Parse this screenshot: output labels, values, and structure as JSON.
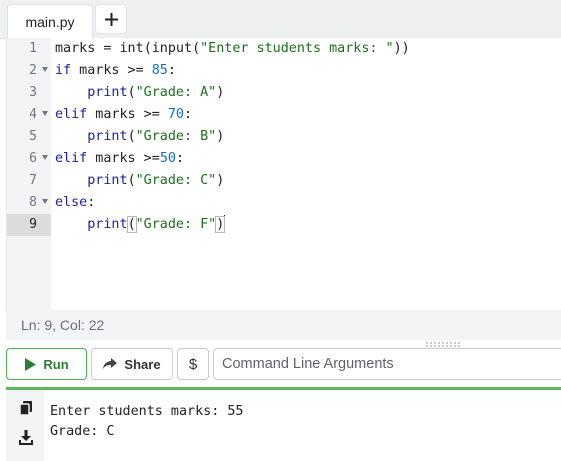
{
  "tabs": {
    "active_file": "main.py",
    "add_label": "+"
  },
  "editor": {
    "line_numbers": [
      "1",
      "2",
      "3",
      "4",
      "5",
      "6",
      "7",
      "8",
      "9"
    ]
  },
  "code": {
    "l1": {
      "a": "marks = ",
      "b": "int",
      "c": "(",
      "d": "input",
      "e": "(",
      "f": "\"Enter students marks: \"",
      "g": "))"
    },
    "l2": {
      "kw": "if",
      "mid": " marks >= ",
      "num": "85",
      "end": ":"
    },
    "l3": {
      "indent": "    ",
      "fn": "print",
      "open": "(",
      "str": "\"Grade: A\"",
      "close": ")"
    },
    "l4": {
      "kw": "elif",
      "mid": " marks >= ",
      "num": "70",
      "end": ":"
    },
    "l5": {
      "indent": "    ",
      "fn": "print",
      "open": "(",
      "str": "\"Grade: B\"",
      "close": ")"
    },
    "l6": {
      "kw": "elif",
      "mid": " marks >=",
      "num": "50",
      "end": ":"
    },
    "l7": {
      "indent": "    ",
      "fn": "print",
      "open": "(",
      "str": "\"Grade: C\"",
      "close": ")"
    },
    "l8": {
      "kw": "else",
      "end": ":"
    },
    "l9": {
      "indent": "    ",
      "fn": "print",
      "open": "(",
      "str": "\"Grade: F\"",
      "close": ")"
    }
  },
  "status": {
    "position": "Ln: 9,  Col: 22"
  },
  "toolbar": {
    "run_label": "Run",
    "share_label": "Share",
    "dollar_label": "$",
    "args_placeholder": "Command Line Arguments"
  },
  "output": {
    "line1": "Enter students marks: 55",
    "line2": "Grade: C"
  },
  "colors": {
    "keyword": "#1e1ea8",
    "string": "#1e6e1e",
    "number": "#0b6ed0",
    "run_accent": "#2e7d32",
    "output_border": "#5cb85c"
  },
  "icons": {
    "run": "play-icon",
    "share": "share-arrow-icon",
    "copy": "copy-icon",
    "download": "download-icon"
  }
}
